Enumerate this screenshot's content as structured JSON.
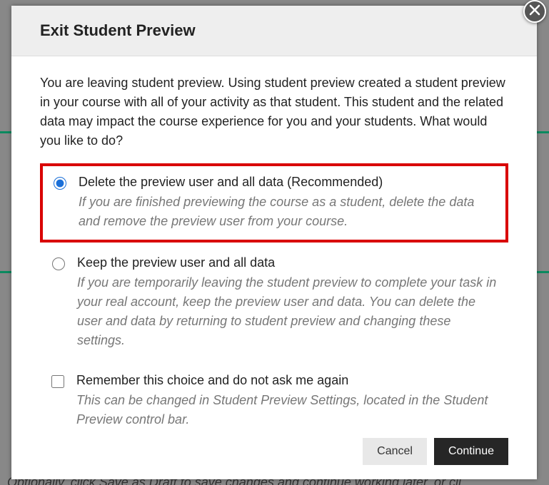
{
  "dialog": {
    "title": "Exit Student Preview",
    "intro": "You are leaving student preview. Using student preview created a student preview in your course with all of your activity as that student. This student and the related data may impact the course experience for you and your students. What would you like to do?",
    "option1": {
      "label": "Delete the preview user and all data (Recommended)",
      "desc": "If you are finished previewing the course as a student, delete the data and remove the preview user from your course."
    },
    "option2": {
      "label": "Keep the preview user and all data",
      "desc": "If you are temporarily leaving the student preview to complete your task in your real account, keep the preview user and data. You can delete the user and data by returning to student preview and changing these settings."
    },
    "remember": {
      "label": "Remember this choice and do not ask me again",
      "desc": "This can be changed in Student Preview Settings, located in the Student Preview control bar."
    },
    "cancel": "Cancel",
    "continue": "Continue"
  },
  "backdrop": {
    "hint": "Optionally, click Save as Draft to save changes and continue working later, or cli"
  }
}
